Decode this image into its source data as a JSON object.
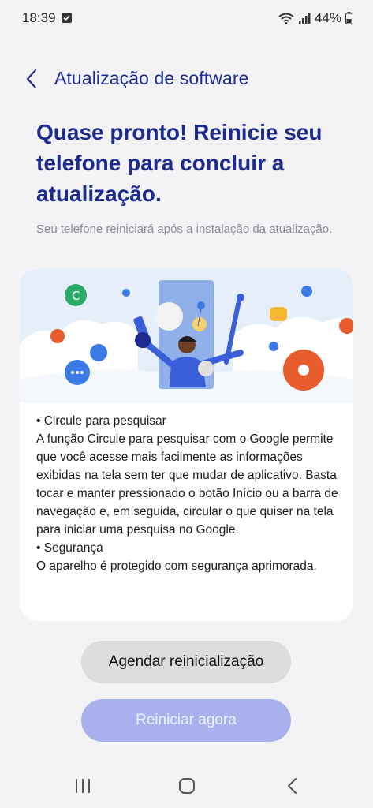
{
  "status": {
    "time": "18:39",
    "battery": "44%",
    "icons": [
      "notification-check-icon",
      "wifi-icon",
      "signal-icon",
      "battery-icon"
    ]
  },
  "header": {
    "title": "Atualização de software",
    "back_icon": "chevron-left-icon"
  },
  "headline": "Quase pronto! Reinicie seu telefone para concluir a atualização.",
  "subtext": "Seu telefone reiniciará após a instalação da atualização.",
  "release_notes": [
    "• Circule para pesquisar",
    "A função Circule para pesquisar com o Google permite que você acesse mais facilmente as informações exibidas na tela sem ter que mudar de aplicativo. Basta tocar e manter pressionado o botão Início ou a barra de navegação e, em seguida, circular o que quiser na tela para iniciar uma pesquisa no Google.",
    "• Segurança",
    "O aparelho é protegido com segurança aprimorada."
  ],
  "buttons": {
    "schedule": "Agendar reinicialização",
    "restart": "Reiniciar agora"
  },
  "colors": {
    "accent": "#1d2a8f",
    "primary_button": "#a8b1ec",
    "secondary_button": "#dcdcdf",
    "background": "#f3f3f5"
  },
  "navbar": {
    "icons": [
      "recents-icon",
      "home-icon",
      "back-icon"
    ]
  }
}
